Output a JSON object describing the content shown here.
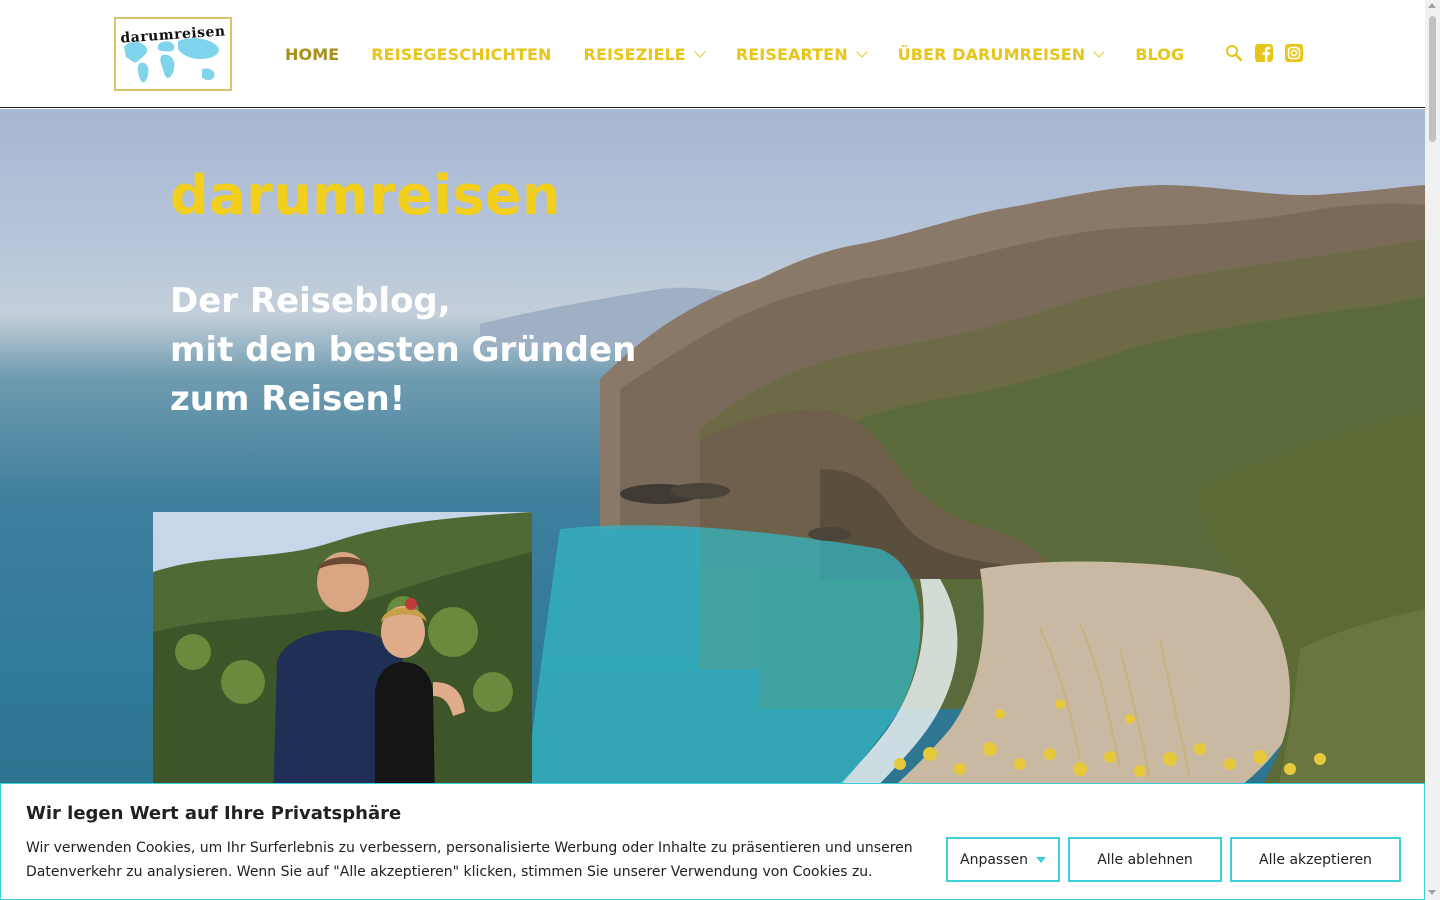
{
  "header": {
    "logo_text": "darumreisen",
    "nav": [
      {
        "label": "HOME",
        "active": true,
        "has_dropdown": false
      },
      {
        "label": "REISEGESCHICHTEN",
        "active": false,
        "has_dropdown": false
      },
      {
        "label": "REISEZIELE",
        "active": false,
        "has_dropdown": true
      },
      {
        "label": "REISEARTEN",
        "active": false,
        "has_dropdown": true
      },
      {
        "label": "ÜBER DARUMREISEN",
        "active": false,
        "has_dropdown": true
      },
      {
        "label": "BLOG",
        "active": false,
        "has_dropdown": false
      }
    ],
    "icons": [
      "search-icon",
      "facebook-icon",
      "instagram-icon"
    ]
  },
  "hero": {
    "title": "darumreisen",
    "subtitle_lines": [
      "Der Reiseblog,",
      "mit den besten Gründen",
      "zum Reisen!"
    ]
  },
  "cookie_banner": {
    "title": "Wir legen Wert auf Ihre Privatsphäre",
    "text": "Wir verwenden Cookies, um Ihr Surferlebnis zu verbessern, personalisierte Werbung oder Inhalte zu präsentieren und unseren Datenverkehr zu analysieren. Wenn Sie auf \"Alle akzeptieren\" klicken, stimmen Sie unserer Verwendung von Cookies zu.",
    "customize_label": "Anpassen",
    "reject_label": "Alle ablehnen",
    "accept_label": "Alle akzeptieren"
  },
  "colors": {
    "brand_yellow": "#f2cf1c",
    "nav_active": "#a98e17",
    "cookie_accent": "#3bd1d7"
  }
}
